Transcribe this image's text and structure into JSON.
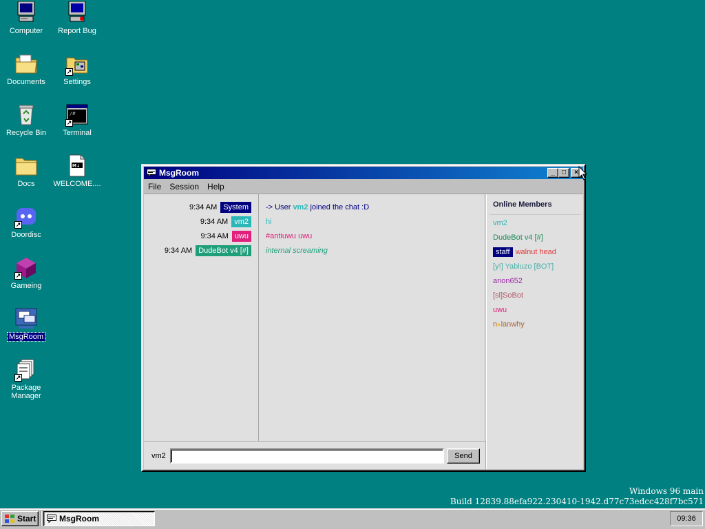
{
  "desktop": {
    "icons": [
      {
        "label": "Computer",
        "icon": "computer-icon"
      },
      {
        "label": "Report Bug",
        "icon": "report-bug-icon"
      },
      {
        "label": "Documents",
        "icon": "documents-folder-icon"
      },
      {
        "label": "Settings",
        "icon": "settings-folder-icon"
      },
      {
        "label": "Recycle Bin",
        "icon": "recycle-bin-icon"
      },
      {
        "label": "Terminal",
        "icon": "terminal-icon"
      },
      {
        "label": "Docs",
        "icon": "docs-folder-icon"
      },
      {
        "label": "WELCOME....",
        "icon": "markdown-file-icon"
      },
      {
        "label": "Doordisc",
        "icon": "doordisc-icon"
      },
      {
        "label": "Gameing",
        "icon": "gameing-icon"
      },
      {
        "label": "MsgRoom",
        "icon": "msgroom-icon"
      },
      {
        "label": "Package Manager",
        "icon": "package-manager-icon"
      }
    ]
  },
  "window": {
    "title": "MsgRoom",
    "minimize_label": "_",
    "maximize_label": "□",
    "close_label": "×",
    "menu": [
      "File",
      "Session",
      "Help"
    ]
  },
  "chat": {
    "messages": [
      {
        "time": "9:34 AM",
        "sender": "System",
        "sender_color": "#000080",
        "text": "-> User ",
        "highlight": "vm2",
        "text_after": " joined the chat :D",
        "text_color": "#000080"
      },
      {
        "time": "9:34 AM",
        "sender": "vm2",
        "sender_color": "#2ab7b7",
        "text": "hi",
        "text_color": "#2ab7b7"
      },
      {
        "time": "9:34 AM",
        "sender": "uwu",
        "sender_color": "#e0207a",
        "text": "#antiuwu uwu",
        "text_color": "#e0207a"
      },
      {
        "time": "9:34 AM",
        "sender": "DudeBot v4 [#]",
        "sender_color": "#1f9e7a",
        "text": "internal screaming",
        "text_color": "#1f9e7a"
      }
    ]
  },
  "members": {
    "title": "Online Members",
    "list": [
      {
        "name": "vm2",
        "color": "#2ab7b7"
      },
      {
        "name": "DudeBot v4 [#]",
        "color": "#1f8a5a"
      },
      {
        "badge": "staff",
        "name": "walnut head",
        "color": "#e03a3a"
      },
      {
        "name": "[y!] Yabluzo [BOT]",
        "color": "#48b0a8"
      },
      {
        "name": "anon652",
        "color": "#9a2aa8"
      },
      {
        "name": "[sl]SoBot",
        "color": "#b05a6a"
      },
      {
        "name": "uwu",
        "color": "#e0207a"
      },
      {
        "name_prefix": "n",
        "name_emoji": "●",
        "name": "lanwhy",
        "color": "#a8663a"
      }
    ]
  },
  "input": {
    "label": "vm2",
    "value": "",
    "placeholder": "",
    "send_label": "Send"
  },
  "build": {
    "line1": "Windows 96 main",
    "line2": "Build 12839.88efa922.230410-1942.d77c73edcc428f7bc571"
  },
  "taskbar": {
    "start_label": "Start",
    "task_label": "MsgRoom",
    "clock": "09:36"
  }
}
